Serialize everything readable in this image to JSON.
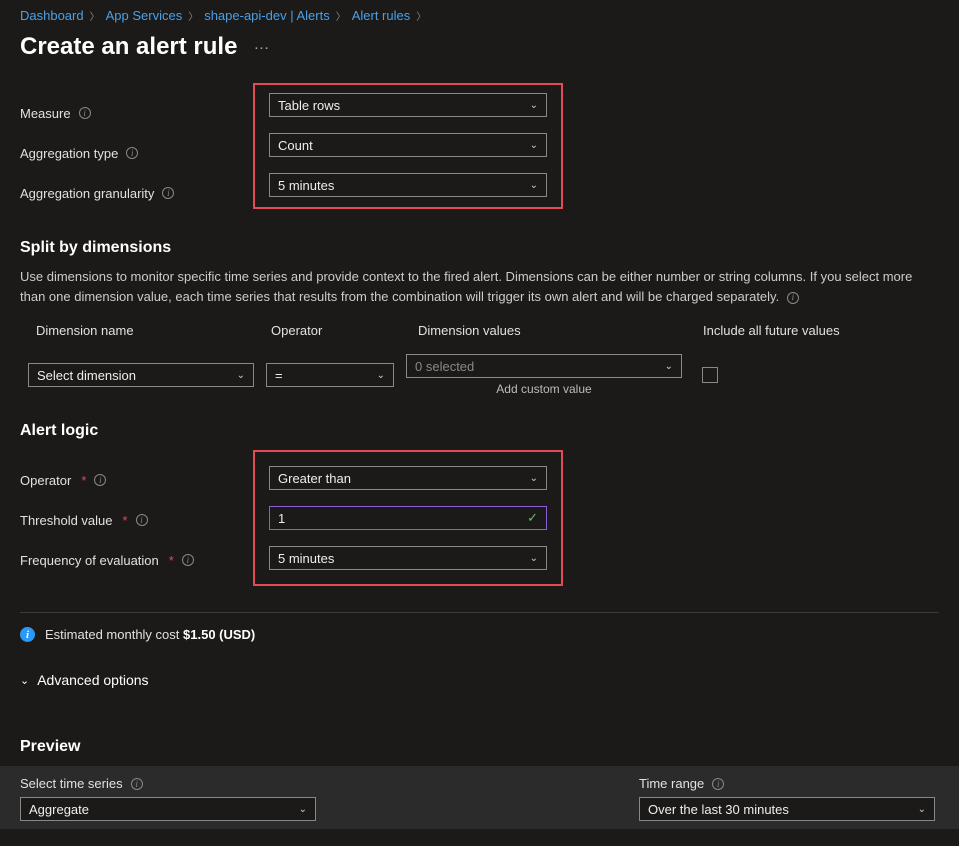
{
  "breadcrumb": {
    "items": [
      "Dashboard",
      "App Services",
      "shape-api-dev | Alerts",
      "Alert rules"
    ]
  },
  "page_title": "Create an alert rule",
  "measure": {
    "labels": {
      "measure": "Measure",
      "agg_type": "Aggregation type",
      "agg_gran": "Aggregation granularity"
    },
    "values": {
      "measure": "Table rows",
      "agg_type": "Count",
      "agg_gran": "5 minutes"
    }
  },
  "split": {
    "title": "Split by dimensions",
    "description": "Use dimensions to monitor specific time series and provide context to the fired alert. Dimensions can be either number or string columns. If you select more than one dimension value, each time series that results from the combination will trigger its own alert and will be charged separately.",
    "columns": {
      "name": "Dimension name",
      "operator": "Operator",
      "values": "Dimension values",
      "include": "Include all future values"
    },
    "row": {
      "name": "Select dimension",
      "operator": "=",
      "values": "0 selected",
      "add_custom": "Add custom value"
    }
  },
  "logic": {
    "title": "Alert logic",
    "labels": {
      "operator": "Operator",
      "threshold": "Threshold value",
      "frequency": "Frequency of evaluation"
    },
    "values": {
      "operator": "Greater than",
      "threshold": "1",
      "frequency": "5 minutes"
    }
  },
  "cost": {
    "prefix": "Estimated monthly cost",
    "value": "$1.50 (USD)"
  },
  "advanced": {
    "label": "Advanced options"
  },
  "preview": {
    "title": "Preview",
    "time_series_label": "Select time series",
    "time_series_value": "Aggregate",
    "time_range_label": "Time range",
    "time_range_value": "Over the last 30 minutes"
  }
}
